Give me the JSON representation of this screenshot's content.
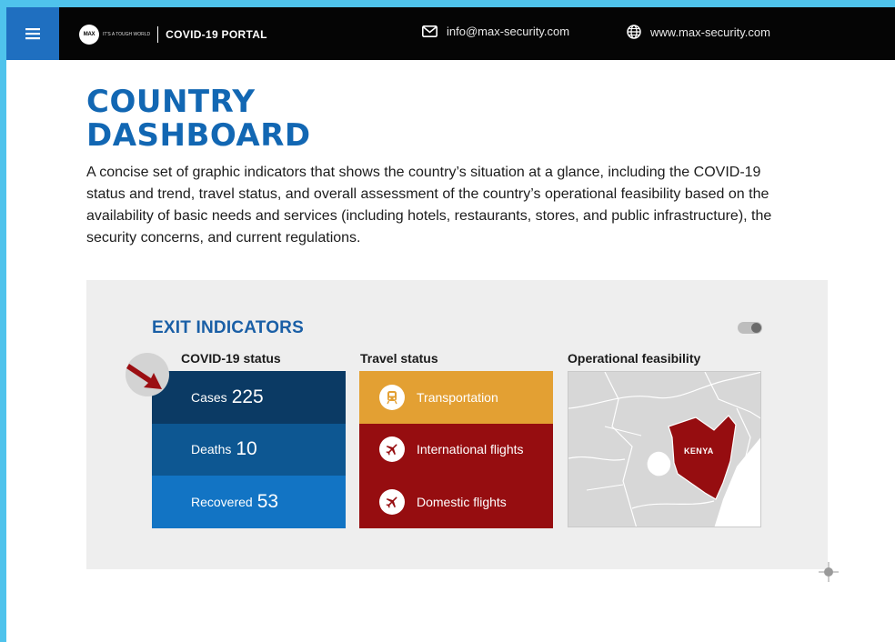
{
  "header": {
    "logo_mark": "MAX",
    "logo_tagline": "IT'S A TOUGH WORLD",
    "portal_title": "COVID-19 PORTAL",
    "email": "info@max-security.com",
    "website": "www.max-security.com",
    "icons": {
      "menu": "hamburger-menu-icon",
      "email": "envelope-icon",
      "web": "globe-icon"
    }
  },
  "page": {
    "title_line1": "COUNTRY",
    "title_line2": "DASHBOARD",
    "description": "A concise set of graphic indicators that shows the country’s situation at a glance, including the COVID-19 status and trend, travel status, and overall assessment of the country’s operational feasibility based on the availability of basic needs and services (including hotels, restaurants, stores, and public infrastructure), the security concerns, and current regulations."
  },
  "dashboard": {
    "title": "EXIT INDICATORS",
    "covid": {
      "label": "COVID-19 status",
      "trend_icon": "arrow-down-right-icon",
      "rows": [
        {
          "label": "Cases",
          "value": "225"
        },
        {
          "label": "Deaths",
          "value": "10"
        },
        {
          "label": "Recovered",
          "value": "53"
        }
      ]
    },
    "travel": {
      "label": "Travel status",
      "rows": [
        {
          "label": "Transportation",
          "icon": "train-icon"
        },
        {
          "label": "International flights",
          "icon": "airplane-icon"
        },
        {
          "label": "Domestic flights",
          "icon": "airplane-icon"
        }
      ]
    },
    "operational": {
      "label": "Operational feasibility",
      "country": "KENYA"
    }
  },
  "colors": {
    "brand_blue": "#1267b3",
    "cases": "#0b3a64",
    "deaths": "#0d5792",
    "recovered": "#1274c4",
    "transport_amber": "#e3a033",
    "flights_red": "#960d10",
    "map_highlight": "#960d10"
  }
}
